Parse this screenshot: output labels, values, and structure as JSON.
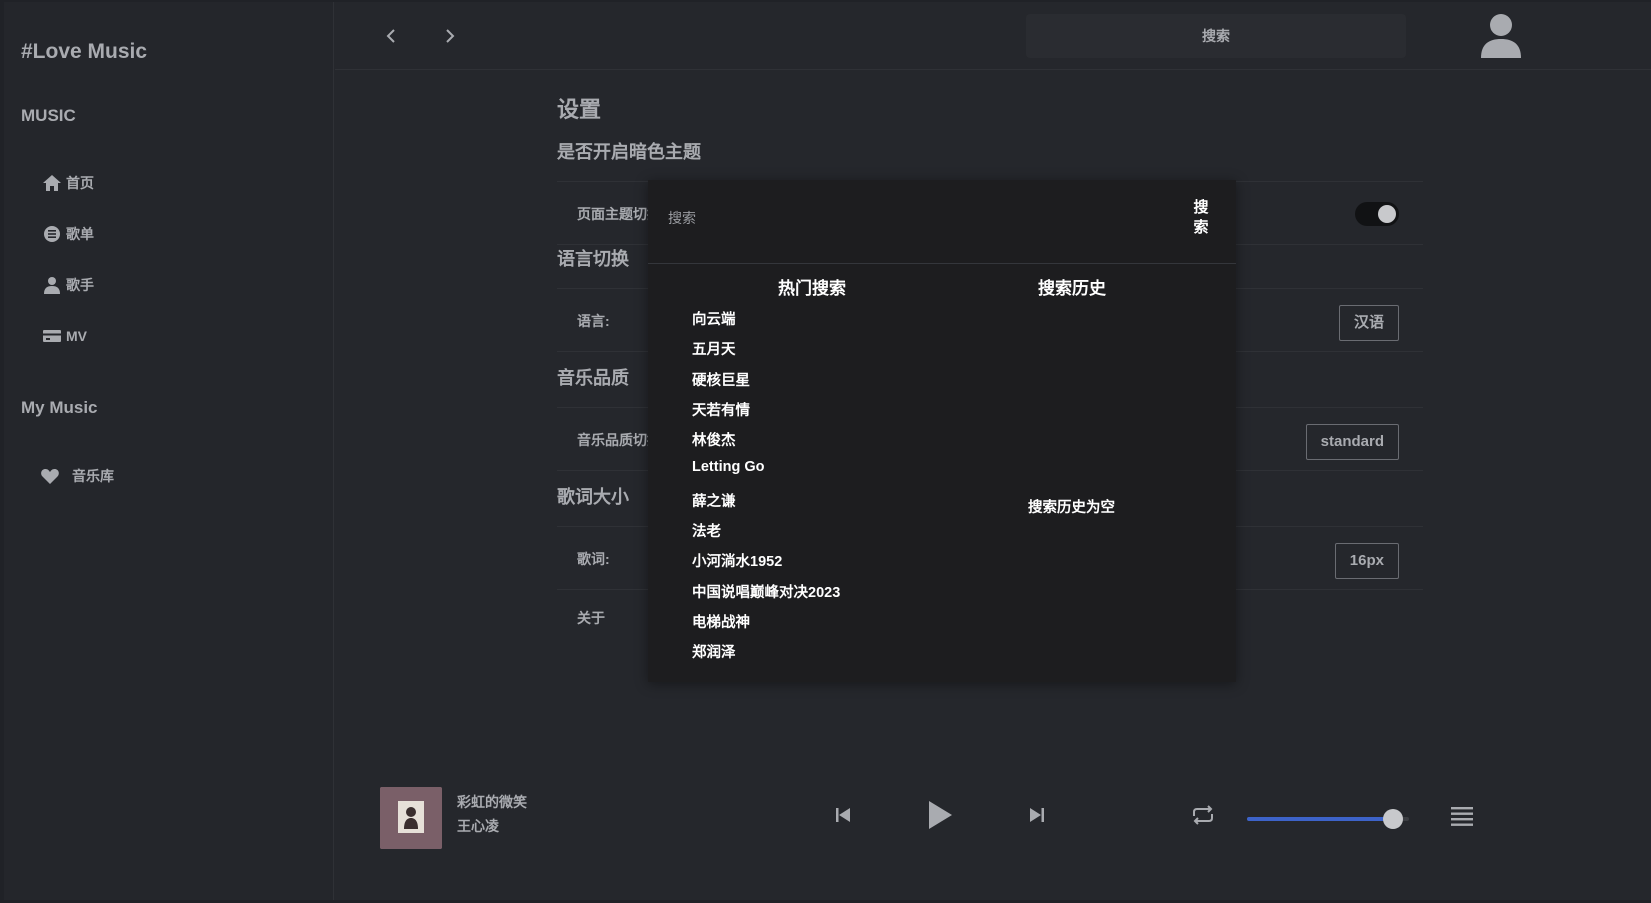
{
  "sidebar": {
    "brand": "#Love Music",
    "music_section": "MUSIC",
    "items": [
      {
        "label": "首页",
        "icon": "home-icon"
      },
      {
        "label": "歌单",
        "icon": "playlist-icon"
      },
      {
        "label": "歌手",
        "icon": "user-icon"
      },
      {
        "label": "MV",
        "icon": "video-icon"
      }
    ],
    "mymusic_section": "My Music",
    "library": {
      "label": "音乐库",
      "icon": "heart-icon"
    }
  },
  "topbar": {
    "search_placeholder": "搜索"
  },
  "settings": {
    "title": "设置",
    "theme_group": "是否开启暗色主题",
    "theme_label": "页面主题切换:",
    "theme_dark": true,
    "language_group": "语言切换",
    "language_label": "语言:",
    "language_value": "汉语",
    "quality_group": "音乐品质",
    "quality_label": "音乐品质切换:",
    "quality_value": "standard",
    "lyric_group": "歌词大小",
    "lyric_label": "歌词:",
    "lyric_value": "16px",
    "about_label": "关于"
  },
  "search_popover": {
    "placeholder": "搜索",
    "button_label": "搜 索",
    "hot_title": "热门搜索",
    "history_title": "搜索历史",
    "history_empty": "搜索历史为空",
    "hot_items": [
      "向云端",
      "五月天",
      "硬核巨星",
      "天若有情",
      "林俊杰",
      "Letting Go",
      "薛之谦",
      "法老",
      "小河淌水1952",
      "中国说唱巅峰对决2023",
      "电梯战神",
      "郑润泽"
    ]
  },
  "player": {
    "song": "彩虹的微笑",
    "singer": "王心凌",
    "volume": 0.9,
    "accent": "#3d63c9"
  }
}
